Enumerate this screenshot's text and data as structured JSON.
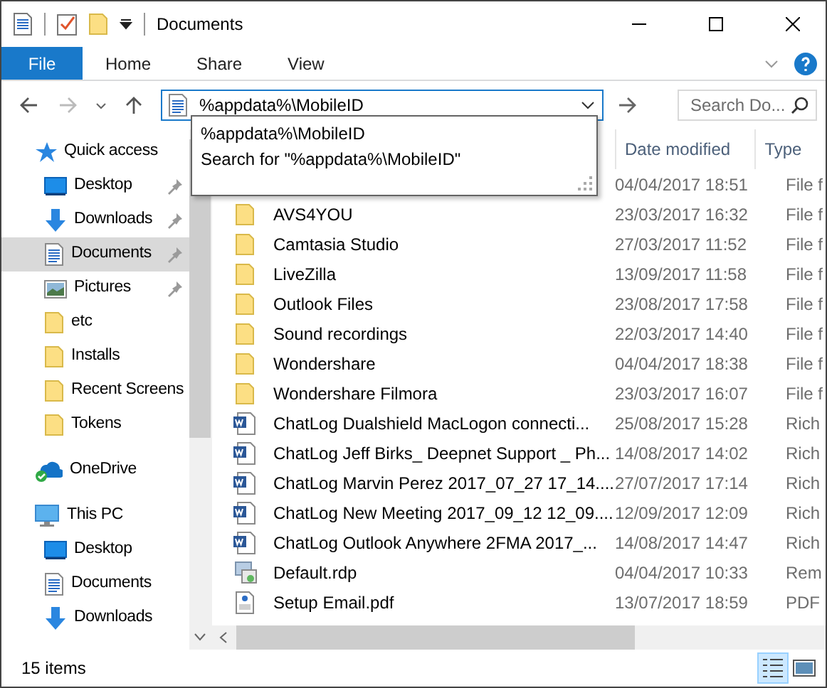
{
  "window": {
    "title": "Documents"
  },
  "ribbon": {
    "file_button": "File",
    "tabs": [
      "Home",
      "Share",
      "View"
    ]
  },
  "address_bar": {
    "value": "%appdata%\\MobileID"
  },
  "suggestions": [
    "%appdata%\\MobileID",
    "Search for \"%appdata%\\MobileID\""
  ],
  "search": {
    "placeholder": "Search Do..."
  },
  "navigation": [
    {
      "label": "Quick access",
      "kind": "star",
      "children": [
        {
          "label": "Desktop",
          "kind": "desktop",
          "pinned": true,
          "selected": false
        },
        {
          "label": "Downloads",
          "kind": "download",
          "pinned": true,
          "selected": false
        },
        {
          "label": "Documents",
          "kind": "document",
          "pinned": true,
          "selected": true
        },
        {
          "label": "Pictures",
          "kind": "pictures",
          "pinned": true,
          "selected": false
        },
        {
          "label": "etc",
          "kind": "folder",
          "pinned": false,
          "selected": false
        },
        {
          "label": "Installs",
          "kind": "folder",
          "pinned": false,
          "selected": false
        },
        {
          "label": "Recent Screens",
          "kind": "folder",
          "pinned": false,
          "selected": false
        },
        {
          "label": "Tokens",
          "kind": "folder",
          "pinned": false,
          "selected": false
        }
      ]
    },
    {
      "label": "OneDrive",
      "kind": "cloud"
    },
    {
      "label": "This PC",
      "kind": "pc",
      "children": [
        {
          "label": "Desktop",
          "kind": "desktop",
          "selected": false
        },
        {
          "label": "Documents",
          "kind": "document",
          "selected": false
        },
        {
          "label": "Downloads",
          "kind": "download",
          "selected": false
        }
      ]
    }
  ],
  "files": {
    "columns": [
      "Date modified",
      "Type"
    ],
    "rows": [
      {
        "kind": "hidden",
        "date": "04/04/2017 18:51",
        "type": "File f"
      },
      {
        "kind": "folder",
        "name": "AVS4YOU",
        "date": "23/03/2017 16:32",
        "type": "File f"
      },
      {
        "kind": "folder",
        "name": "Camtasia Studio",
        "date": "27/03/2017 11:52",
        "type": "File f"
      },
      {
        "kind": "folder",
        "name": "LiveZilla",
        "date": "13/09/2017 11:58",
        "type": "File f"
      },
      {
        "kind": "folder",
        "name": "Outlook Files",
        "date": "23/08/2017 17:58",
        "type": "File f"
      },
      {
        "kind": "folder",
        "name": "Sound recordings",
        "date": "22/03/2017 14:40",
        "type": "File f"
      },
      {
        "kind": "folder",
        "name": "Wondershare",
        "date": "04/04/2017 18:38",
        "type": "File f"
      },
      {
        "kind": "folder",
        "name": "Wondershare Filmora",
        "date": "23/03/2017 16:07",
        "type": "File f"
      },
      {
        "kind": "word",
        "name": "ChatLog Dualshield MacLogon connecti...",
        "date": "25/08/2017 15:28",
        "type": "Rich"
      },
      {
        "kind": "word",
        "name": "ChatLog Jeff Birks_ Deepnet Support _ Ph...",
        "date": "14/08/2017 14:02",
        "type": "Rich"
      },
      {
        "kind": "word",
        "name": "ChatLog Marvin Perez  2017_07_27 17_14....",
        "date": "27/07/2017 17:14",
        "type": "Rich"
      },
      {
        "kind": "word",
        "name": "ChatLog New Meeting 2017_09_12 12_09....",
        "date": "12/09/2017 12:09",
        "type": "Rich"
      },
      {
        "kind": "word",
        "name": "ChatLog Outlook Anywhere 2FMA 2017_...",
        "date": "14/08/2017 14:47",
        "type": "Rich"
      },
      {
        "kind": "rdp",
        "name": "Default.rdp",
        "date": "04/04/2017 10:33",
        "type": "Rem"
      },
      {
        "kind": "pdf",
        "name": "Setup Email.pdf",
        "date": "13/07/2017 18:59",
        "type": "PDF"
      }
    ]
  },
  "status_bar": {
    "count": "15 items",
    "views": [
      {
        "kind": "details",
        "selected": true
      },
      {
        "kind": "tiles",
        "selected": false
      }
    ]
  }
}
